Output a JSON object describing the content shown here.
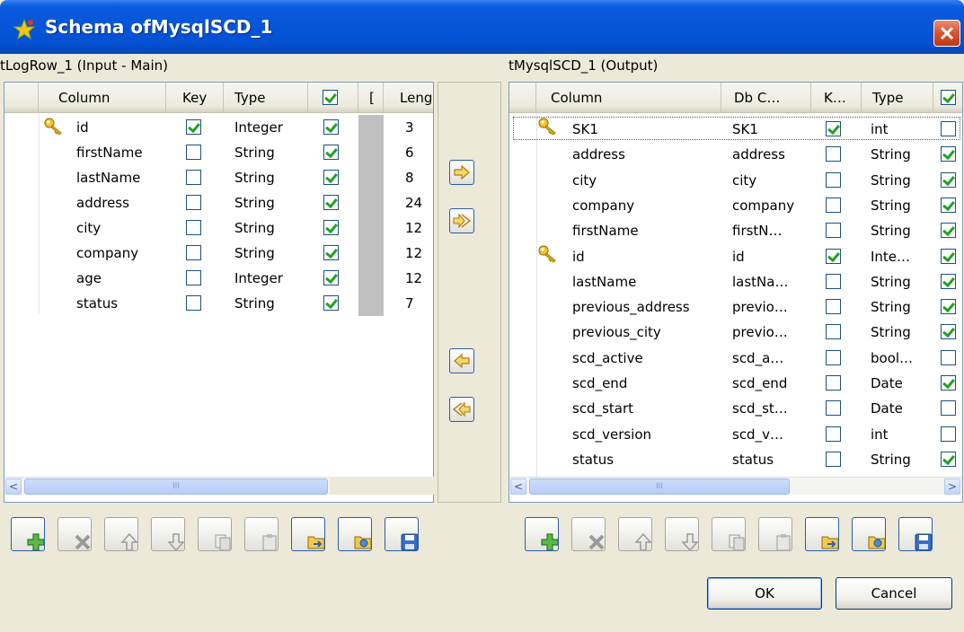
{
  "window": {
    "title": "Schema ofMysqlSCD_1"
  },
  "input": {
    "label": "tLogRow_1 (Input - Main)",
    "columns": [
      "Column",
      "Key",
      "Type",
      "",
      "[",
      "Leng"
    ],
    "rows": [
      {
        "name": "id",
        "key": true,
        "type": "Integer",
        "nullable": true,
        "length": "3",
        "primary": true
      },
      {
        "name": "firstName",
        "key": false,
        "type": "String",
        "nullable": true,
        "length": "6"
      },
      {
        "name": "lastName",
        "key": false,
        "type": "String",
        "nullable": true,
        "length": "8"
      },
      {
        "name": "address",
        "key": false,
        "type": "String",
        "nullable": true,
        "length": "24"
      },
      {
        "name": "city",
        "key": false,
        "type": "String",
        "nullable": true,
        "length": "12"
      },
      {
        "name": "company",
        "key": false,
        "type": "String",
        "nullable": true,
        "length": "12"
      },
      {
        "name": "age",
        "key": false,
        "type": "Integer",
        "nullable": true,
        "length": "12"
      },
      {
        "name": "status",
        "key": false,
        "type": "String",
        "nullable": true,
        "length": "7"
      }
    ]
  },
  "output": {
    "label": "tMysqlSCD_1 (Output)",
    "columns": [
      "Column",
      "Db C…",
      "K…",
      "Type",
      ""
    ],
    "rows": [
      {
        "name": "SK1",
        "db": "SK1",
        "key": true,
        "type": "int",
        "nullable": false,
        "primary": true
      },
      {
        "name": "address",
        "db": "address",
        "key": false,
        "type": "String",
        "nullable": true
      },
      {
        "name": "city",
        "db": "city",
        "key": false,
        "type": "String",
        "nullable": true
      },
      {
        "name": "company",
        "db": "company",
        "key": false,
        "type": "String",
        "nullable": true
      },
      {
        "name": "firstName",
        "db": "firstN…",
        "key": false,
        "type": "String",
        "nullable": true
      },
      {
        "name": "id",
        "db": "id",
        "key": true,
        "type": "Inte…",
        "nullable": true,
        "primary": true
      },
      {
        "name": "lastName",
        "db": "lastNa…",
        "key": false,
        "type": "String",
        "nullable": true
      },
      {
        "name": "previous_address",
        "db": "previo…",
        "key": false,
        "type": "String",
        "nullable": true
      },
      {
        "name": "previous_city",
        "db": "previo…",
        "key": false,
        "type": "String",
        "nullable": true
      },
      {
        "name": "scd_active",
        "db": "scd_a…",
        "key": false,
        "type": "bool…",
        "nullable": false
      },
      {
        "name": "scd_end",
        "db": "scd_end",
        "key": false,
        "type": "Date",
        "nullable": true
      },
      {
        "name": "scd_start",
        "db": "scd_st…",
        "key": false,
        "type": "Date",
        "nullable": false
      },
      {
        "name": "scd_version",
        "db": "scd_v…",
        "key": false,
        "type": "int",
        "nullable": false
      },
      {
        "name": "status",
        "db": "status",
        "key": false,
        "type": "String",
        "nullable": true
      }
    ]
  },
  "buttons": {
    "ok": "OK",
    "cancel": "Cancel"
  },
  "scroll": {
    "thumb_glyph": "III",
    "left_arrow": "<",
    "right_arrow": ">"
  },
  "icons": {
    "copy_right": "arrow-right-icon",
    "copy_all_right": "double-arrow-right-icon",
    "copy_left": "arrow-left-icon",
    "copy_all_left": "double-arrow-left-icon",
    "toolbar": [
      "add-icon",
      "delete-icon",
      "move-up-icon",
      "move-down-icon",
      "copy-icon",
      "paste-icon",
      "import-icon",
      "export-icon",
      "save-icon"
    ]
  }
}
